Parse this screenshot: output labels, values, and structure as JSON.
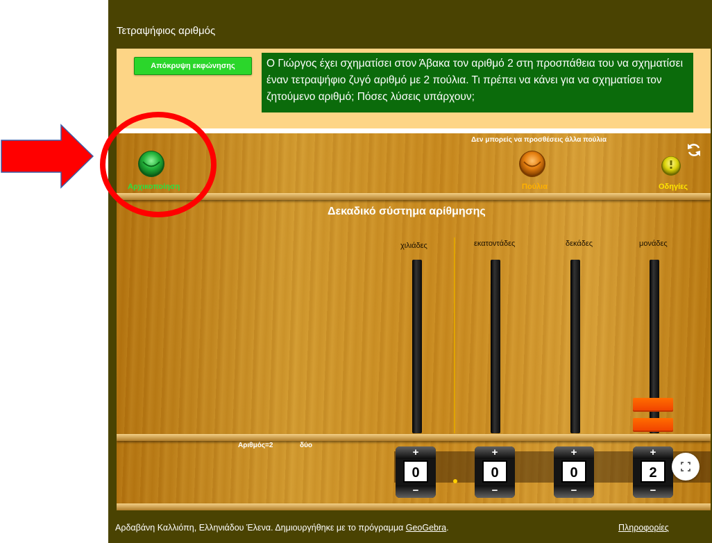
{
  "header": {
    "title": "Τετραψήφιος αριθμός"
  },
  "prompt": {
    "hide_button": "Απόκρυψη εκφώνησης",
    "statement": "Ο Γιώργος  έχει σχηματίσει στον Άβακα  τον αριθμό 2 στη προσπάθεια του να σχηματίσει έναν τετραψήφιο ζυγό αριθμό με 2 πούλια. Τι πρέπει να κάνει για να σχηματίσει τον ζητούμενο αριθμό; Πόσες λύσεις υπάρχουν;"
  },
  "toolbar": {
    "message": "Δεν μπορείς να προσθέσεις άλλα πούλια",
    "reset_label": "Αρχικοποίηση",
    "beads_label": "Πούλια",
    "help_label": "Οδηγίες"
  },
  "abacus": {
    "title": "Δεκαδικό σύστημα αρίθμησης",
    "columns": [
      {
        "label": "χιλιάδες",
        "value": "0",
        "beads": 0
      },
      {
        "label": "εκατοντάδες",
        "value": "0",
        "beads": 0
      },
      {
        "label": "δεκάδες",
        "value": "0",
        "beads": 0
      },
      {
        "label": "μονάδες",
        "value": "2",
        "beads": 2
      }
    ],
    "number_label": "Αριθμός=2",
    "number_words": "δύο",
    "plus_symbol": "+",
    "minus_symbol": "−"
  },
  "footer": {
    "credits_text": "Αρδαβάνη Καλλιόπη, Ελληνιάδου Έλενα. Δημιουργήθηκε με το πρόγραμμα ",
    "geogebra_link": "GeoGebra",
    "period": ".",
    "info_link": "Πληροφορίες"
  },
  "colors": {
    "frame": "#4a4302",
    "prompt_bg": "#fdd586",
    "statement_bg": "#0b6b0b",
    "hide_button": "#2bd62b",
    "reset_button": "#27b63a",
    "beads_button": "#e57f0f",
    "help_button": "#dcd40c",
    "bead": "#ff5200",
    "annotation_red": "#ff0000"
  },
  "icons": [
    "refresh-icon",
    "fullscreen-icon",
    "red-arrow-annotation",
    "red-circle-annotation"
  ]
}
